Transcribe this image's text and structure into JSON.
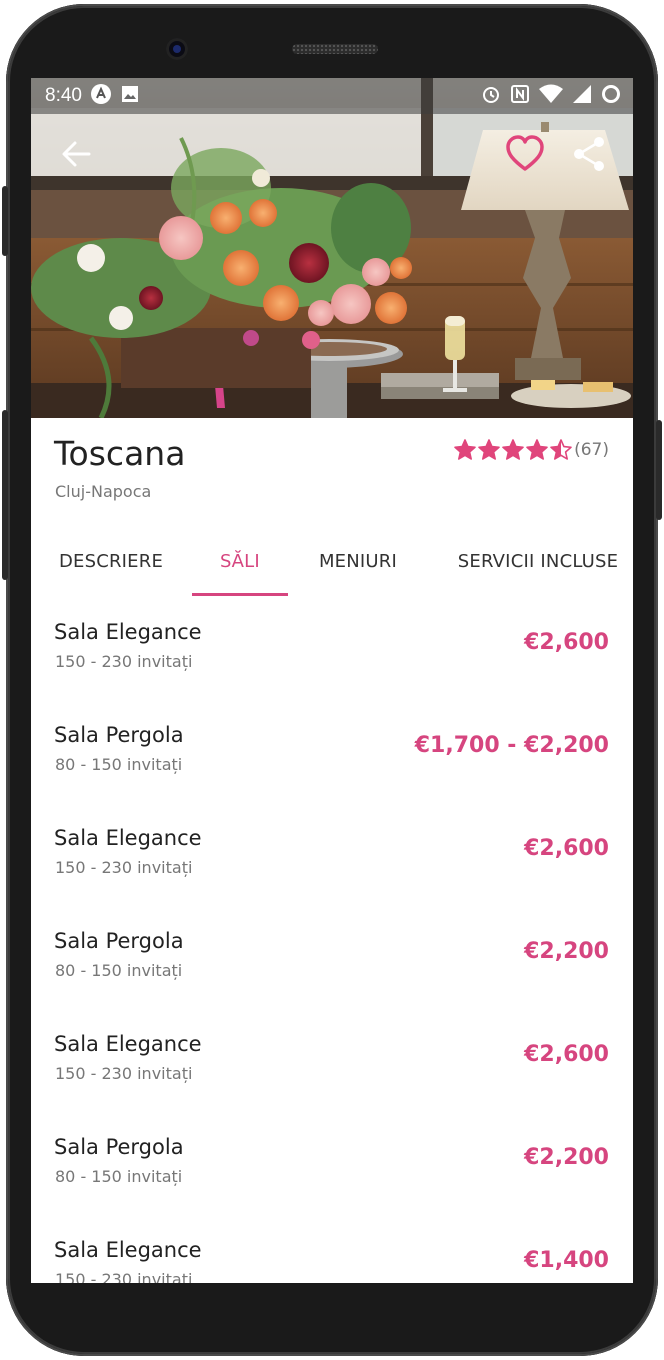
{
  "status_bar": {
    "time": "8:40",
    "left_icons": [
      "app-notification-icon",
      "image-icon"
    ],
    "right_icons": [
      "alarm-icon",
      "nfc-icon",
      "wifi-icon",
      "signal-icon",
      "battery-icon"
    ]
  },
  "header": {
    "back_icon": "arrow-left-icon",
    "favorite_icon": "heart-outline-icon",
    "share_icon": "share-icon"
  },
  "venue": {
    "name": "Toscana",
    "city": "Cluj-Napoca",
    "rating": 4.5,
    "rating_count": "(67)"
  },
  "tabs": [
    {
      "label": "DESCRIERE",
      "active": false
    },
    {
      "label": "SĂLI",
      "active": true
    },
    {
      "label": "MENIURI",
      "active": false
    },
    {
      "label": "SERVICII INCLUSE",
      "active": false
    }
  ],
  "halls": [
    {
      "name": "Sala Elegance",
      "guests": "150 - 230 invitați",
      "price": "€2,600"
    },
    {
      "name": "Sala Pergola",
      "guests": "80 - 150 invitați",
      "price": "€1,700 - €2,200"
    },
    {
      "name": "Sala Elegance",
      "guests": "150 - 230 invitați",
      "price": "€2,600"
    },
    {
      "name": "Sala Pergola",
      "guests": "80 - 150 invitați",
      "price": "€2,200"
    },
    {
      "name": "Sala Elegance",
      "guests": "150 - 230 invitați",
      "price": "€2,600"
    },
    {
      "name": "Sala Pergola",
      "guests": "80 - 150 invitați",
      "price": "€2,200"
    },
    {
      "name": "Sala Elegance",
      "guests": "150 - 230 invitați",
      "price": "€1,400"
    }
  ],
  "colors": {
    "accent": "#d6457f",
    "star": "#e0457b",
    "text_primary": "#222222",
    "text_secondary": "#777777"
  }
}
